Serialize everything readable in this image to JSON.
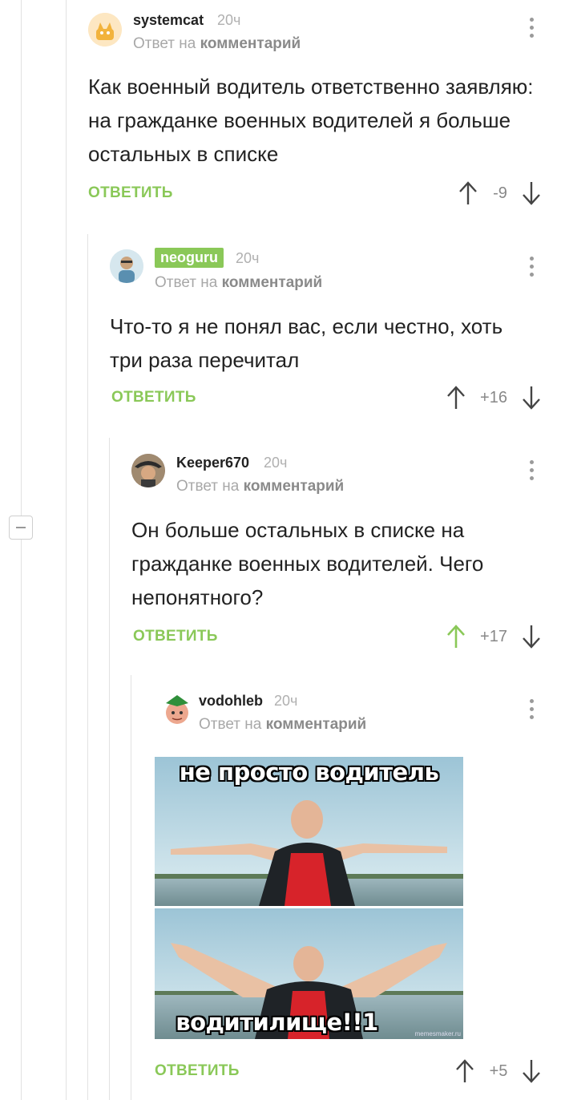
{
  "reply_prefix": "Ответ на",
  "reply_link": "комментарий",
  "reply_label": "ОТВЕТИТЬ",
  "comments": [
    {
      "username": "systemcat",
      "time": "20ч",
      "text": "Как военный водитель ответственно заявляю: на гражданке военных водителей я больше остальных в списке",
      "rating": "-9",
      "avatar_icon": "cat-avatar-icon"
    },
    {
      "username": "neoguru",
      "username_badge": true,
      "time": "20ч",
      "text": "Что-то я не понял вас, если честно, хоть три раза перечитал",
      "rating": "+16",
      "avatar_icon": "user-avatar-icon"
    },
    {
      "username": "Keeper670",
      "time": "20ч",
      "text": "Он больше остальных в списке на гражданке военных водителей. Чего непонятного?",
      "rating": "+17",
      "upvoted": true,
      "avatar_icon": "pirate-avatar-icon"
    },
    {
      "username": "vodohleb",
      "time": "20ч",
      "rating": "+5",
      "avatar_icon": "cartoon-avatar-icon",
      "meme": {
        "top_text": "не просто водитель",
        "bottom_text": "водитилище!!1",
        "watermark": "memesmaker.ru"
      }
    }
  ],
  "colors": {
    "accent_green": "#8ac858",
    "text": "#222222",
    "muted": "#a8a8a8"
  }
}
